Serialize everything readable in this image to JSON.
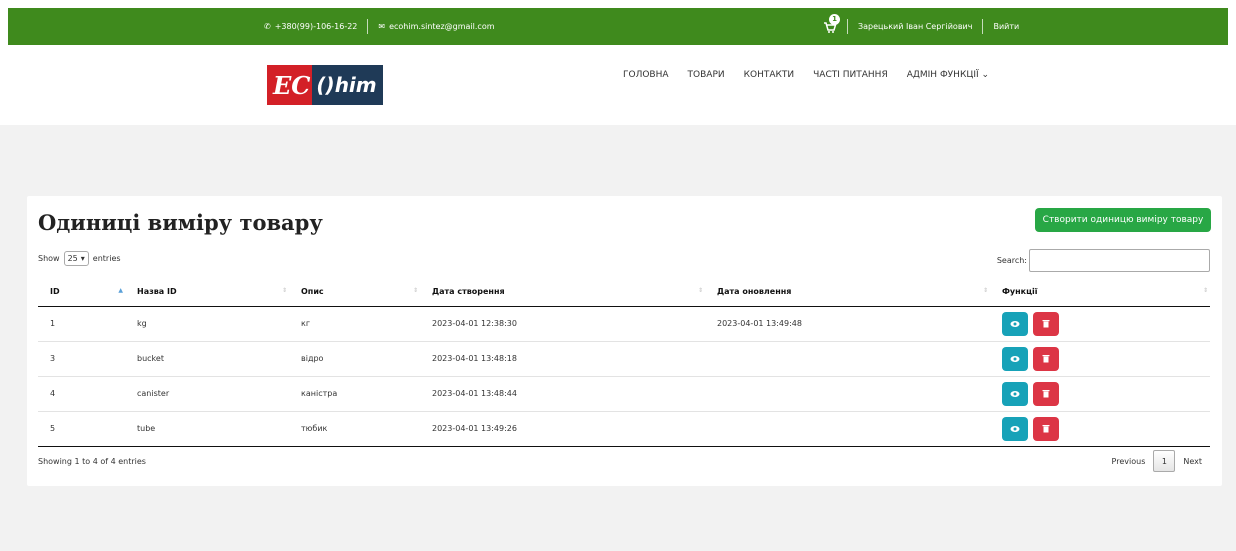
{
  "topbar": {
    "phone": "+380(99)-106-16-22",
    "email": "ecohim.sintez@gmail.com",
    "cart_count": "1",
    "user_name": "Зарецький Іван Сергійович",
    "logout": "Вийти"
  },
  "logo": {
    "part1": "EC",
    "part2": "()him"
  },
  "nav": {
    "items": [
      "ГОЛОВНА",
      "ТОВАРИ",
      "КОНТАКТИ",
      "ЧАСТІ ПИТАННЯ",
      "АДМІН ФУНКЦІЇ"
    ],
    "dropdown_icon": "chevron-down-icon"
  },
  "page": {
    "title": "Одиниці виміру товару",
    "create_button": "Створити одиницю виміру товару"
  },
  "table_controls": {
    "show_label": "Show",
    "entries_value": "25",
    "entries_label": "entries",
    "search_label": "Search:",
    "search_value": ""
  },
  "table": {
    "headers": [
      "ID",
      "Назва ID",
      "Опис",
      "Дата створення",
      "Дата оновлення",
      "Функції"
    ],
    "rows": [
      [
        "1",
        "kg",
        "кг",
        "2023-04-01 12:38:30",
        "2023-04-01 13:49:48"
      ],
      [
        "3",
        "bucket",
        "відро",
        "2023-04-01 13:48:18",
        ""
      ],
      [
        "4",
        "canister",
        "каністра",
        "2023-04-01 13:48:44",
        ""
      ],
      [
        "5",
        "tube",
        "тюбик",
        "2023-04-01 13:49:26",
        ""
      ]
    ]
  },
  "footer": {
    "info": "Showing 1 to 4 of 4 entries",
    "previous": "Previous",
    "page": "1",
    "next": "Next"
  },
  "colors": {
    "topbar": "#3f8a1d",
    "create_button": "#28a745",
    "view_button": "#17a2b8",
    "delete_button": "#dc3545",
    "nav_underline": "#7ab336"
  }
}
